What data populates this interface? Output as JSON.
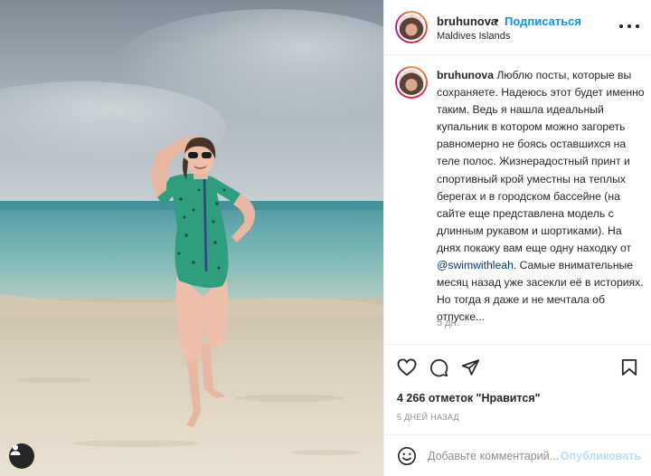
{
  "post": {
    "username": "bruhunova",
    "separator": "•",
    "follow_label": "Подписаться",
    "location": "Maldives Islands",
    "more_icon": "more-horizontal-icon"
  },
  "caption": {
    "username": "bruhunova",
    "text_before_mention": "Люблю посты, которые вы сохраняете. Надеюсь этот будет именно таким. Ведь я нашла идеальный купальник в котором можно загореть равномерно не боясь оставшихся на теле полос. Жизнерадостный принт и спортивный крой уместны на теплых берегах и в городском бассейне (на сайте еще представлена модель с длинным рукавом и шортиками). На днях покажу вам еще одну находку от",
    "mention": "@swimwithleah",
    "text_after_mention": ". Самые внимательные месяц назад уже засекли её в историях. Но тогда я даже и не мечтала об отпуске...",
    "time": "5 дн."
  },
  "actions": {
    "like_icon": "heart-icon",
    "comment_icon": "comment-icon",
    "share_icon": "paper-plane-icon",
    "save_icon": "bookmark-icon"
  },
  "stats": {
    "likes": "4 266 отметок \"Нравится\"",
    "date": "5 ДНЕЙ НАЗАД"
  },
  "comment": {
    "placeholder": "Добавьте комментарий...",
    "publish_label": "Опубликовать",
    "emoji_icon": "smiley-icon"
  },
  "photo": {
    "user_tag_icon": "user-tag-icon"
  },
  "colors": {
    "accent": "#0095f6",
    "publish_disabled": "#b2dffc",
    "text": "#262626",
    "muted": "#8e8e8e",
    "mention": "#00376b"
  }
}
